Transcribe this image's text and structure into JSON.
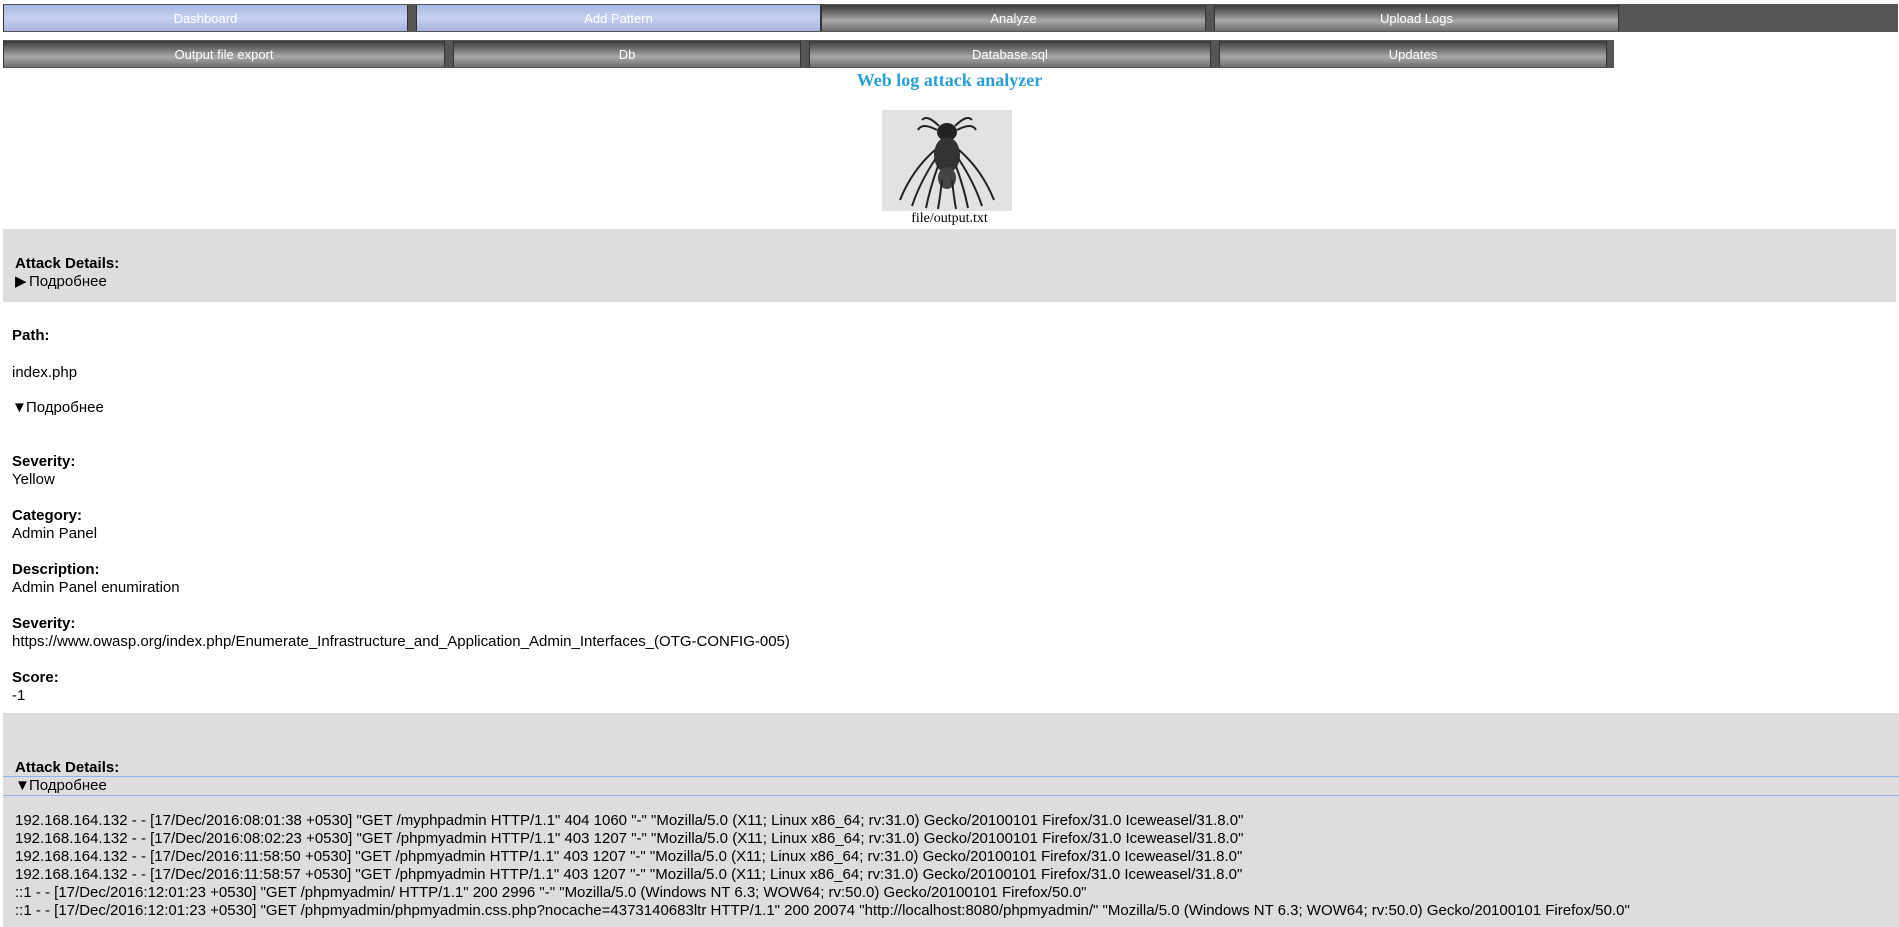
{
  "nav": {
    "row1": [
      "Dashboard",
      "Add Pattern",
      "Analyze",
      "Upload Logs"
    ],
    "row2": [
      "Output file export",
      "Db",
      "Database.sql",
      "Updates"
    ]
  },
  "header": {
    "title": "Web log attack analyzer",
    "file_caption": "file/output.txt"
  },
  "block1": {
    "heading": "Attack Details:",
    "summary": "Подробнее"
  },
  "details": {
    "path_label": "Path:",
    "path_value": "index.php",
    "summary": "Подробнее",
    "severity_label": "Severity:",
    "severity_value": "Yellow",
    "category_label": "Category:",
    "category_value": "Admin Panel",
    "description_label": "Description:",
    "description_value": "Admin Panel enumiration",
    "severity2_label": "Severity:",
    "severity2_value": "https://www.owasp.org/index.php/Enumerate_Infrastructure_and_Application_Admin_Interfaces_(OTG-CONFIG-005)",
    "score_label": "Score:",
    "score_value": "-1"
  },
  "block2": {
    "heading": "Attack Details:",
    "summary": "Подробнее",
    "log_lines": [
      "192.168.164.132 - - [17/Dec/2016:08:01:38 +0530] \"GET /myphpadmin HTTP/1.1\" 404 1060 \"-\" \"Mozilla/5.0 (X11; Linux x86_64; rv:31.0) Gecko/20100101 Firefox/31.0 Iceweasel/31.8.0\"",
      "192.168.164.132 - - [17/Dec/2016:08:02:23 +0530] \"GET /phpmyadmin HTTP/1.1\" 403 1207 \"-\" \"Mozilla/5.0 (X11; Linux x86_64; rv:31.0) Gecko/20100101 Firefox/31.0 Iceweasel/31.8.0\"",
      "192.168.164.132 - - [17/Dec/2016:11:58:50 +0530] \"GET /phpmyadmin HTTP/1.1\" 403 1207 \"-\" \"Mozilla/5.0 (X11; Linux x86_64; rv:31.0) Gecko/20100101 Firefox/31.0 Iceweasel/31.8.0\"",
      "192.168.164.132 - - [17/Dec/2016:11:58:57 +0530] \"GET /phpmyadmin HTTP/1.1\" 403 1207 \"-\" \"Mozilla/5.0 (X11; Linux x86_64; rv:31.0) Gecko/20100101 Firefox/31.0 Iceweasel/31.8.0\"",
      "::1 - - [17/Dec/2016:12:01:23 +0530] \"GET /phpmyadmin/ HTTP/1.1\" 200 2996 \"-\" \"Mozilla/5.0 (Windows NT 6.3; WOW64; rv:50.0) Gecko/20100101 Firefox/50.0\"",
      "::1 - - [17/Dec/2016:12:01:23 +0530] \"GET /phpmyadmin/phpmyadmin.css.php?nocache=4373140683ltr HTTP/1.1\" 200 20074 \"http://localhost:8080/phpmyadmin/\" \"Mozilla/5.0 (Windows NT 6.3; WOW64; rv:50.0) Gecko/20100101 Firefox/50.0\""
    ]
  }
}
